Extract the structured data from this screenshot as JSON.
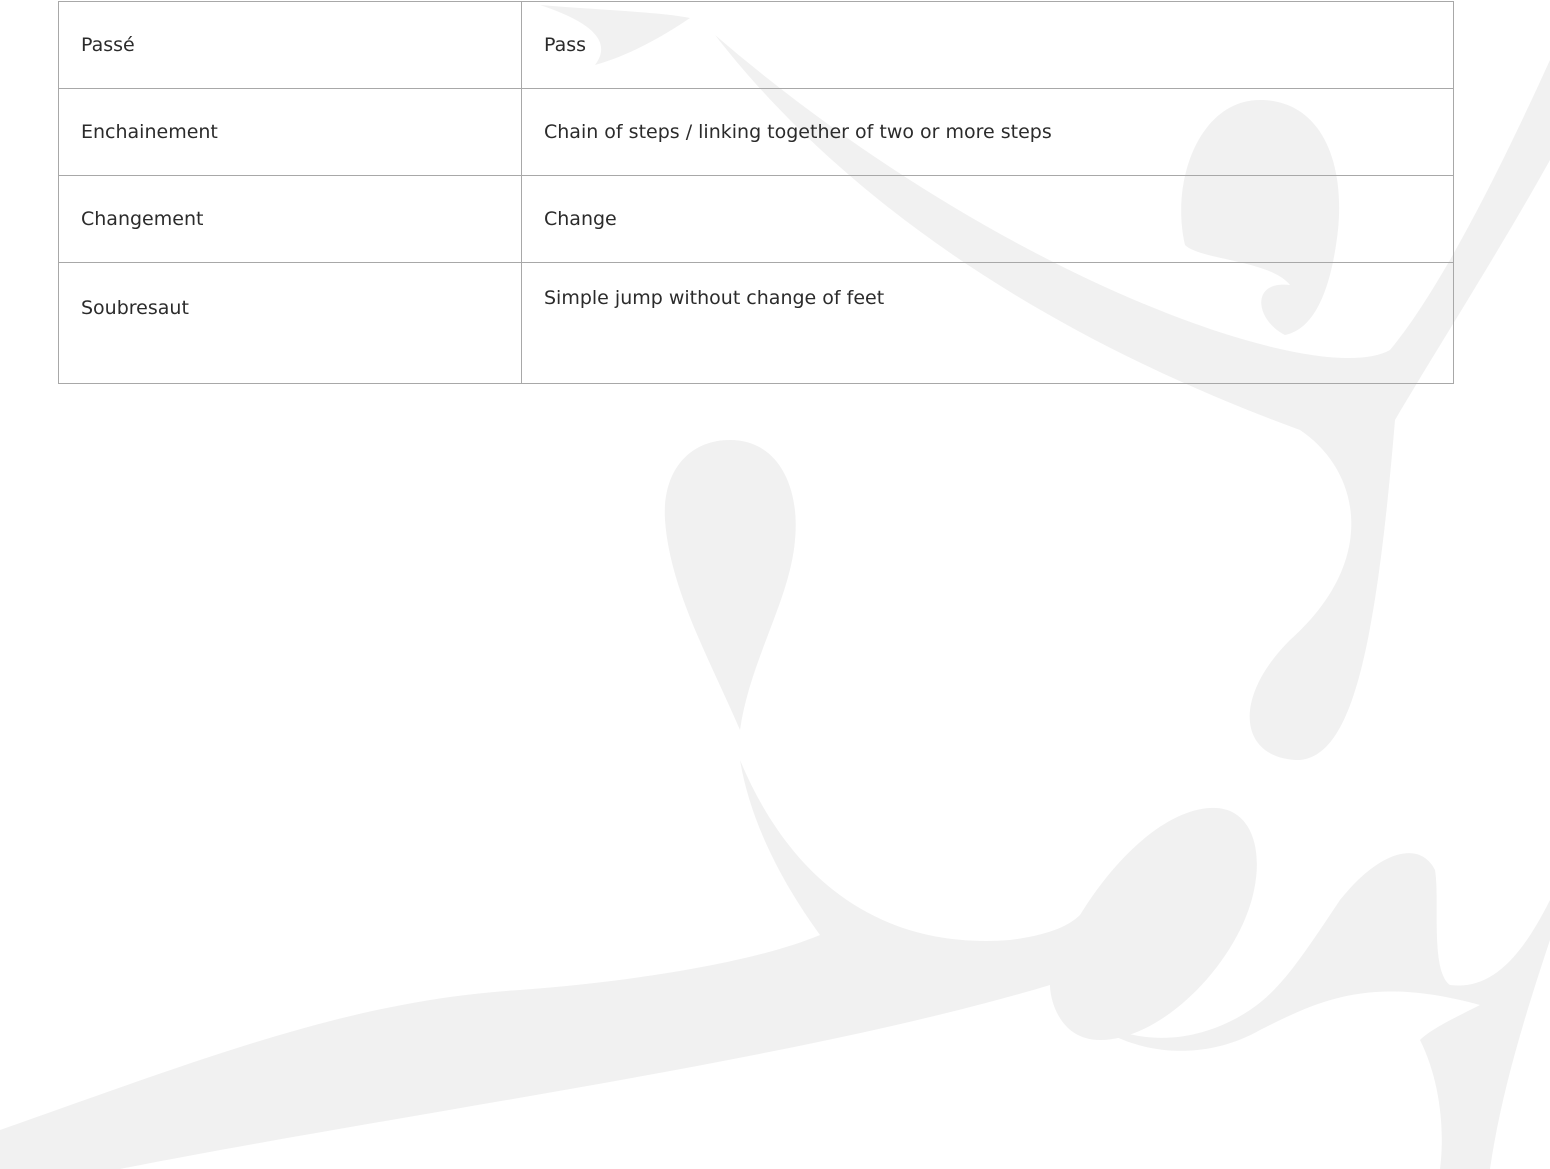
{
  "glossary": {
    "rows": [
      {
        "term": "Passé",
        "meaning": "Pass"
      },
      {
        "term": "Enchainement",
        "meaning": "Chain of steps / linking together of two or more steps"
      },
      {
        "term": "Changement",
        "meaning": "Change"
      },
      {
        "term": "Soubresaut",
        "meaning": "Simple jump without change of feet"
      }
    ]
  },
  "colors": {
    "text": "#2b2b2b",
    "border": "#a8a8a8",
    "watermark": "#f1f1f1",
    "background": "#ffffff"
  },
  "icons": {
    "watermark": "dancer-silhouette-watermark"
  }
}
